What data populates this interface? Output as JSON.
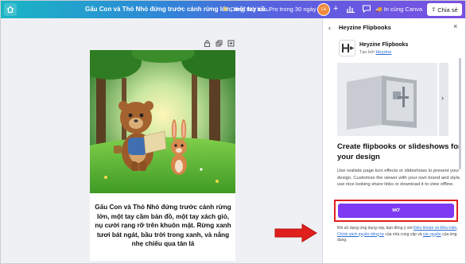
{
  "topbar": {
    "doc_title": "Gấu Con và Thỏ Nhỏ đứng trước cánh rừng lớn, một tay cầ...",
    "trial_label": "Dùng thử bản Pro trong 30 ngày",
    "print_label": "In cùng Canva",
    "share_label": "Chia sẻ",
    "avatar_initials": "LA"
  },
  "page": {
    "caption": "Gấu Con và Thỏ Nhỏ đứng trước cánh rừng lớn, một tay cầm bản đồ, một tay xách giỏ, nụ cười rạng rỡ trên khuôn mặt. Rừng xanh tươi bát ngát, bầu trời trong xanh, và nắng nhẹ chiếu qua tán lá"
  },
  "panel": {
    "header_title": "Heyzine Flipbooks",
    "app_name": "Heyzine Flipbooks",
    "by_prefix": "Tạo bởi",
    "by_link": "Heyzine",
    "headline": "Create flipbooks or slideshows for your design",
    "description": "Use realistic page turn effects or slideshows to present your design. Customize the viewer with your own brand and style, use nice looking share links or download it to view offline.",
    "open_button": "MỞ",
    "terms": {
      "p1": "Khi sử dụng ứng dụng này, bạn đồng ý với ",
      "l1": "Điều khoản và Điều kiện",
      "p2": ", ",
      "l2": "Chính sách quyền riêng tư",
      "p3": " của nhà cung cấp và ",
      "l3": "các quyền",
      "p4": " của ứng dụng."
    }
  },
  "colors": {
    "accent": "#7d3af2",
    "highlight_border": "#e0201d",
    "arrow": "#e0201d"
  }
}
